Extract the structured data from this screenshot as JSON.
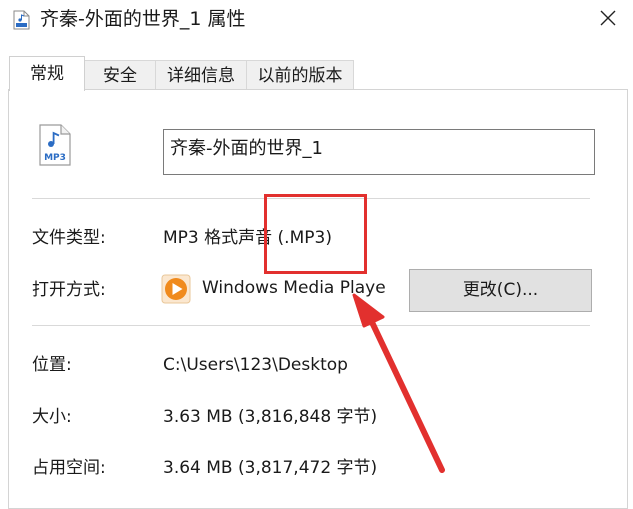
{
  "window": {
    "title": "齐秦-外面的世界_1 属性",
    "close_glyph": "✕"
  },
  "tabs": [
    {
      "label": "常规",
      "active": true
    },
    {
      "label": "安全",
      "active": false
    },
    {
      "label": "详细信息",
      "active": false
    },
    {
      "label": "以前的版本",
      "active": false
    }
  ],
  "general": {
    "file_icon_text": "MP3",
    "file_name": "齐秦-外面的世界_1",
    "type_label": "文件类型:",
    "type_value": "MP3 格式声音 (.MP3)",
    "opens_label": "打开方式:",
    "opens_value": "Windows Media Playe",
    "change_button": "更改(C)...",
    "location_label": "位置:",
    "location_value": "C:\\Users\\123\\Desktop",
    "size_label": "大小:",
    "size_value": "3.63 MB (3,816,848 字节)",
    "disk_label": "占用空间:",
    "disk_value": "3.64 MB (3,817,472 字节)"
  },
  "icons": [
    "mp3-file-icon",
    "windows-media-player-icon",
    "close-icon"
  ],
  "colors": {
    "annotation": "#e2302e",
    "button_bg": "#e1e1e1",
    "wmp_orange": "#f08a1c"
  }
}
